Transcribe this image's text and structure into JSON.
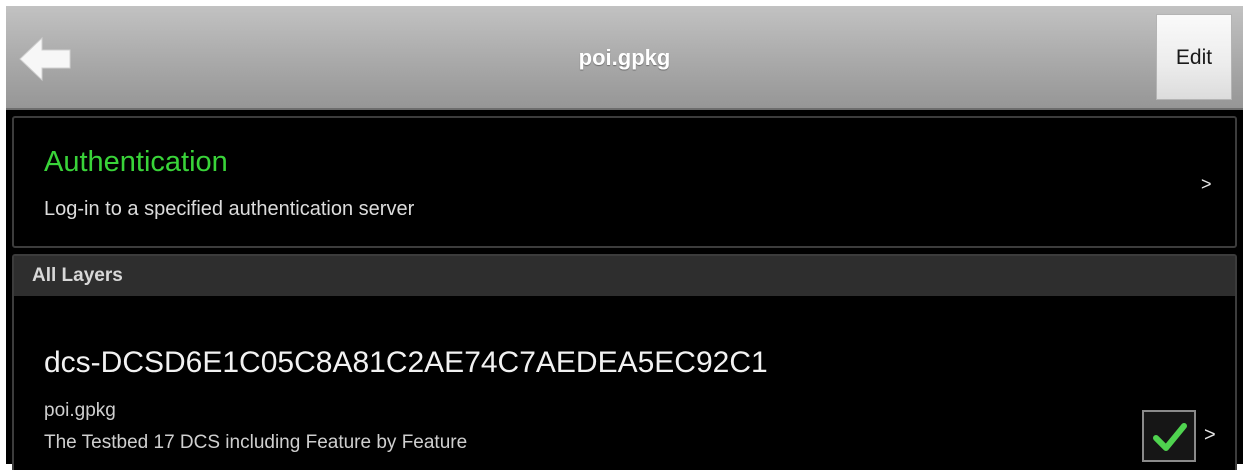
{
  "titlebar": {
    "title": "poi.gpkg",
    "back_icon": "back-arrow-icon",
    "edit_label": "Edit"
  },
  "auth": {
    "title": "Authentication",
    "subtitle": "Log-in to a specified authentication server",
    "chevron": ">",
    "title_color": "#39d339"
  },
  "layers": {
    "header": "All Layers",
    "items": [
      {
        "name": "dcs-DCSD6E1C05C8A81C2AE74C7AEDEA5EC92C1",
        "file": "poi.gpkg",
        "description": "The Testbed 17 DCS including Feature by Feature",
        "checked": true,
        "check_icon": "checkmark-icon",
        "chevron": ">"
      }
    ]
  }
}
